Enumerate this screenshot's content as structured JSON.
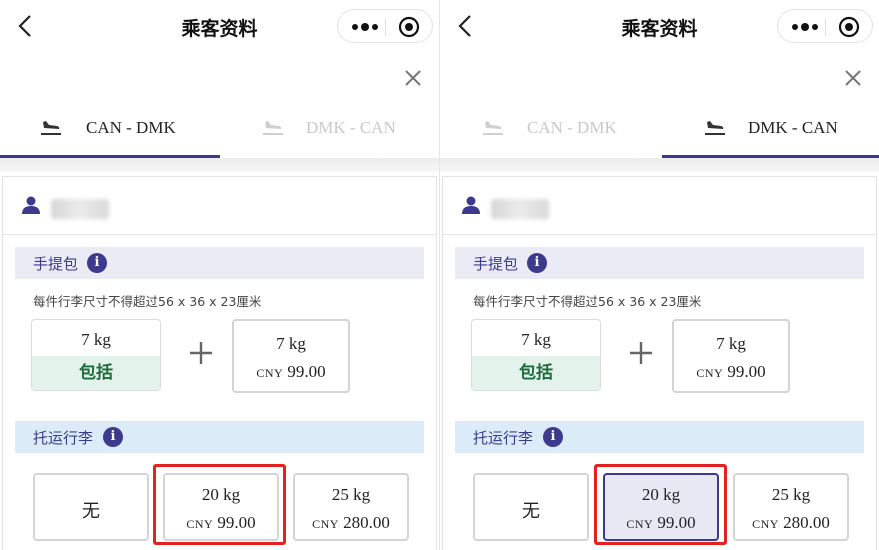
{
  "nav": {
    "title": "乘客资料"
  },
  "panels": [
    {
      "tabs": [
        {
          "label": "CAN - DMK",
          "active": true
        },
        {
          "label": "DMK - CAN",
          "active": false
        }
      ]
    },
    {
      "tabs": [
        {
          "label": "CAN - DMK",
          "active": false
        },
        {
          "label": "DMK - CAN",
          "active": true
        }
      ]
    }
  ],
  "cabin": {
    "title": "手提包",
    "info_label": "i",
    "note": "每件行李尺寸不得超过56 x 36 x 23厘米",
    "included": {
      "weight": "7 kg",
      "tag": "包括"
    },
    "addon": {
      "weight": "7 kg",
      "currency": "CNY",
      "amount": "99.00"
    }
  },
  "checked": {
    "title": "托运行李",
    "info_label": "i",
    "none_label": "无",
    "options": [
      {
        "weight": "20 kg",
        "currency": "CNY",
        "amount": "99.00"
      },
      {
        "weight": "25 kg",
        "currency": "CNY",
        "amount": "280.00"
      }
    ]
  },
  "colors": {
    "accent": "#3c3a8c",
    "included_bg": "#e3f2ea",
    "included_text": "#1c6b3a",
    "highlight": "#e32121"
  },
  "icons": [
    "back-arrow-icon",
    "more-dots-icon",
    "target-icon",
    "close-icon",
    "plane-landing-icon",
    "user-icon",
    "info-icon",
    "plus-icon"
  ]
}
